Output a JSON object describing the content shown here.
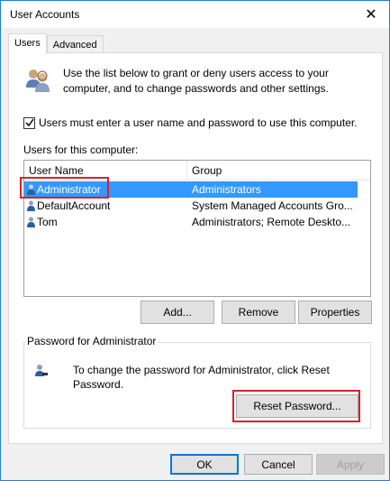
{
  "window": {
    "title": "User Accounts",
    "close_glyph": "✕"
  },
  "tabs": [
    {
      "label": "Users",
      "active": true
    },
    {
      "label": "Advanced",
      "active": false
    }
  ],
  "intro": {
    "text": "Use the list below to grant or deny users access to your computer, and to change passwords and other settings.",
    "icon": "users-icon"
  },
  "must_login": {
    "label": "Users must enter a user name and password to use this computer.",
    "checked": true
  },
  "users_section": {
    "label": "Users for this computer:",
    "columns": [
      "User Name",
      "Group"
    ],
    "rows": [
      {
        "name": "Administrator",
        "group": "Administrators",
        "selected": true
      },
      {
        "name": "DefaultAccount",
        "group": "System Managed Accounts Gro...",
        "selected": false
      },
      {
        "name": "Tom",
        "group": "Administrators; Remote Deskto...",
        "selected": false
      }
    ]
  },
  "list_buttons": {
    "add": "Add...",
    "remove": "Remove",
    "properties": "Properties"
  },
  "password_group": {
    "title": "Password for Administrator",
    "text": "To change the password for Administrator, click Reset Password.",
    "reset_label": "Reset Password..."
  },
  "footer": {
    "ok": "OK",
    "cancel": "Cancel",
    "apply": "Apply",
    "apply_enabled": false
  },
  "colors": {
    "selection": "#3399ff",
    "accent": "#0078d7",
    "highlight": "#d7202a"
  }
}
